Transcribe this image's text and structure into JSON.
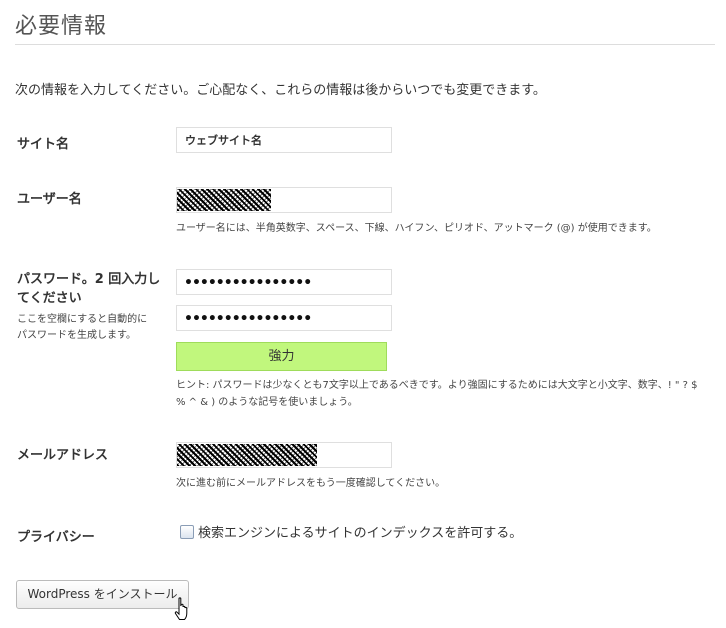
{
  "page": {
    "title": "必要情報",
    "intro": "次の情報を入力してください。ご心配なく、これらの情報は後からいつでも変更できます。"
  },
  "form": {
    "site_name": {
      "label": "サイト名",
      "value": "ウェブサイト名"
    },
    "username": {
      "label": "ユーザー名",
      "hint": "ユーザー名には、半角英数字、スペース、下線、ハイフン、ピリオド、アットマーク (@) が使用できます。"
    },
    "password": {
      "label_line1": "パスワード。2 回入力し",
      "label_line2": "てください",
      "sub_line1": "ここを空欄にすると自動的に",
      "sub_line2": "パスワードを生成します。",
      "value1": "••••••••••••••••",
      "value2": "••••••••••••••••",
      "strength": "強力",
      "hint_line1": "ヒント: パスワードは少なくとも7文字以上であるべきです。より強固にするためには大文字と小文字、数字、! \" ? $",
      "hint_line2": "% ^ & ) のような記号を使いましょう。"
    },
    "email": {
      "label": "メールアドレス",
      "hint": "次に進む前にメールアドレスをもう一度確認してください。"
    },
    "privacy": {
      "label": "プライバシー",
      "checkbox_label": "検索エンジンによるサイトのインデックスを許可する。",
      "checked": false
    },
    "install_button": "WordPress をインストール"
  }
}
